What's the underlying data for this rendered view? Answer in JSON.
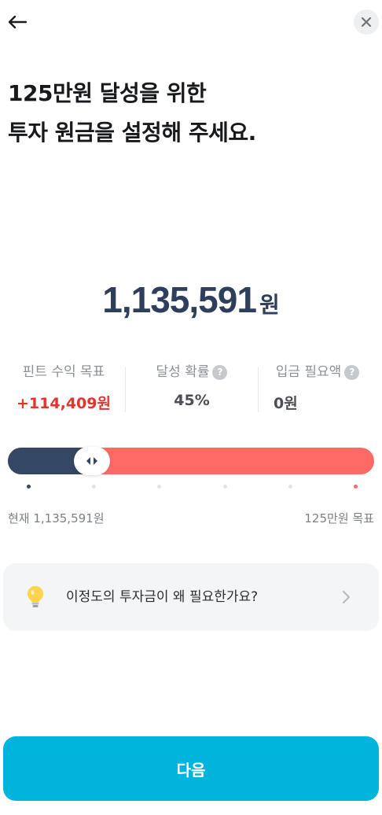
{
  "header": {
    "back_icon": "arrow-left-icon",
    "close_icon": "close-icon"
  },
  "heading": {
    "line1": "125만원 달성을 위한",
    "line2": "투자 원금을 설정해 주세요."
  },
  "amount": {
    "value": "1,135,591",
    "unit": "원"
  },
  "stats": [
    {
      "label": "핀트 수익 목표",
      "value": "+114,409원",
      "has_help": false,
      "value_color": "#e5322d"
    },
    {
      "label": "달성 확률",
      "value": "45%",
      "has_help": true,
      "value_color": "#4b4f55"
    },
    {
      "label": "입금 필요액",
      "value": "0원",
      "has_help": true,
      "value_color": "#4b4f55"
    }
  ],
  "slider": {
    "position": 0.23,
    "tick_count": 6,
    "fill_color": "#344764",
    "track_color": "#ff6b64",
    "left_label": "현재 1,135,591원",
    "right_label": "125만원 목표"
  },
  "info_card": {
    "icon": "lightbulb-icon",
    "text": "이정도의 투자금이 왜 필요한가요?",
    "chevron_icon": "chevron-right-icon"
  },
  "next_button": {
    "label": "다음",
    "color": "#00b4dc"
  }
}
